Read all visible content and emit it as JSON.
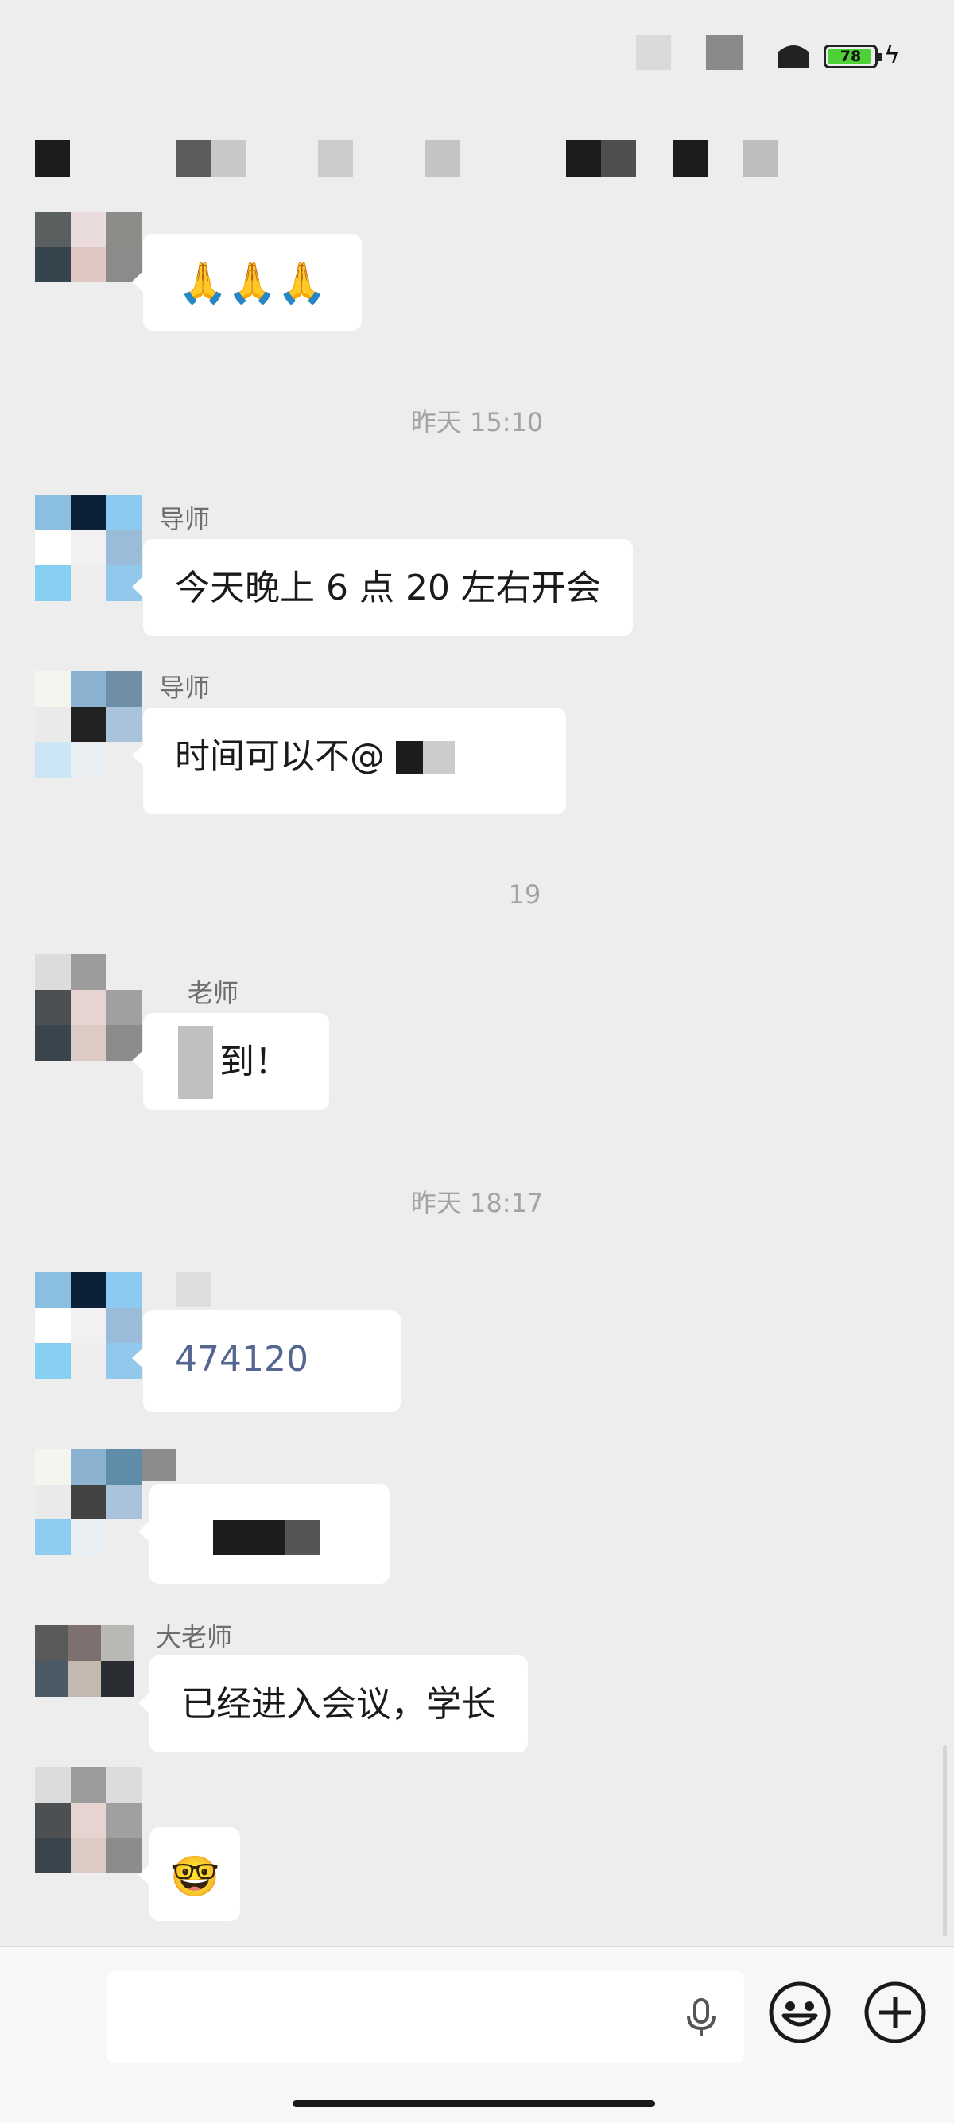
{
  "status_bar": {
    "battery_level": "78",
    "charging_icon": "bolt-icon",
    "signal_icon": "wifi-icon"
  },
  "messages": [
    {
      "sender": "",
      "content": "🙏🙏🙏",
      "type": "emoji"
    },
    {
      "timestamp": "昨天 15:10"
    },
    {
      "sender": "导师",
      "content": "今天晚上 6 点 20 左右开会",
      "type": "text"
    },
    {
      "sender": "导师",
      "content": "时间可以不@",
      "type": "text"
    },
    {
      "timestamp": "19"
    },
    {
      "sender": "老师",
      "content": "到！",
      "type": "text"
    },
    {
      "timestamp": "昨天 18:17"
    },
    {
      "sender": "",
      "content": "474120",
      "type": "link"
    },
    {
      "sender": "",
      "content": "",
      "type": "text"
    },
    {
      "sender": "大老师",
      "content": "已经进入会议，学长",
      "type": "text"
    },
    {
      "sender": "",
      "content": "🤓",
      "type": "emoji"
    }
  ],
  "input_bar": {
    "placeholder": "",
    "voice_icon": "microphone-icon",
    "emoji_icon": "smiley-icon",
    "more_icon": "plus-circle-icon"
  },
  "colors": {
    "background": "#ededed",
    "bubble": "#ffffff",
    "timestamp": "#a3a3a3",
    "link": "#55678f",
    "battery_fill": "#4cd137"
  }
}
